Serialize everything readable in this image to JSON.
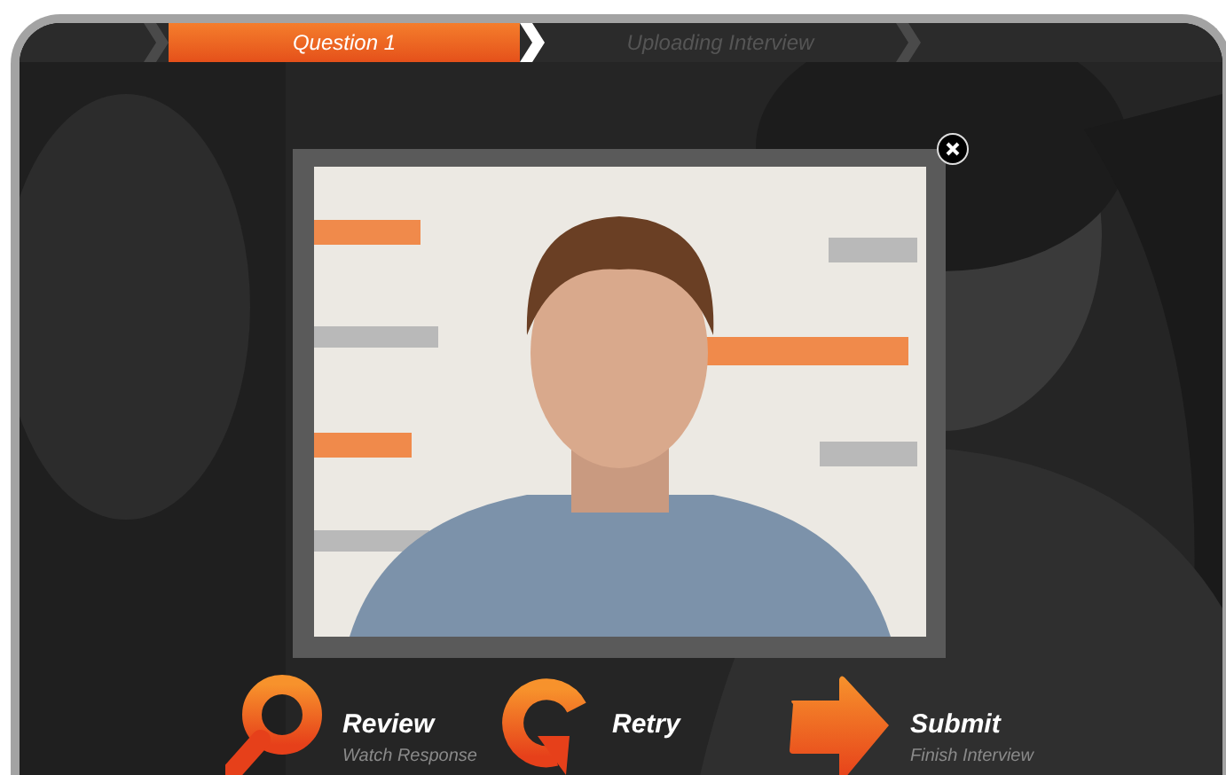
{
  "steps": [
    {
      "label": "Question 1",
      "selected": true
    },
    {
      "label": "Uploading Interview",
      "selected": false
    }
  ],
  "actions": [
    {
      "kind": "review",
      "label": "Review",
      "sublabel": "Watch Response"
    },
    {
      "kind": "retry",
      "label": "Retry"
    },
    {
      "kind": "submit",
      "label": "Submit",
      "sublabel": "Finish Interview"
    }
  ]
}
